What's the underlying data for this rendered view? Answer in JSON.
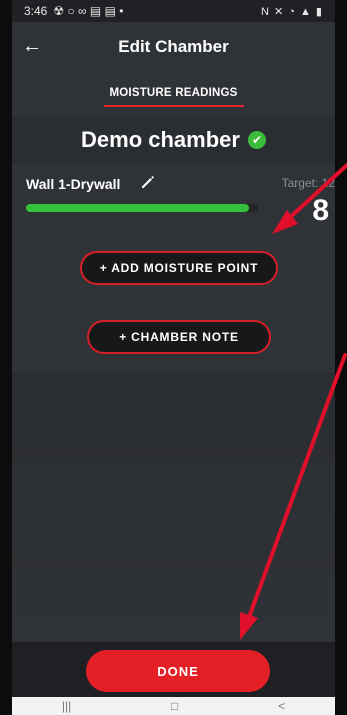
{
  "status_bar": {
    "time": "3:46",
    "left_icons": "☢ ○ ∞ ▤ ▤ •",
    "right_icons": "N ✕ ◔ ▲ ▮"
  },
  "header": {
    "title": "Edit Chamber",
    "back_icon": "←"
  },
  "tabs": [
    {
      "label": "MOISTURE READINGS",
      "active": true
    }
  ],
  "chamber": {
    "name": "Demo chamber",
    "status_icon": "✔"
  },
  "readings": [
    {
      "label": "Wall 1-Drywall",
      "target_text": "Target: 12",
      "value": "8",
      "progress": 0.96
    }
  ],
  "actions": {
    "add_moisture_point": "+ ADD MOISTURE POINT",
    "chamber_note": "+ CHAMBER NOTE"
  },
  "footer": {
    "done_label": "DONE"
  },
  "nav_bar": {
    "recent": "|||",
    "home": "□",
    "back": "<"
  },
  "colors": {
    "accent_red": "#e51f26",
    "progress_green": "#35c23a",
    "check_green": "#3bbd3b",
    "background": "#2f3236"
  }
}
